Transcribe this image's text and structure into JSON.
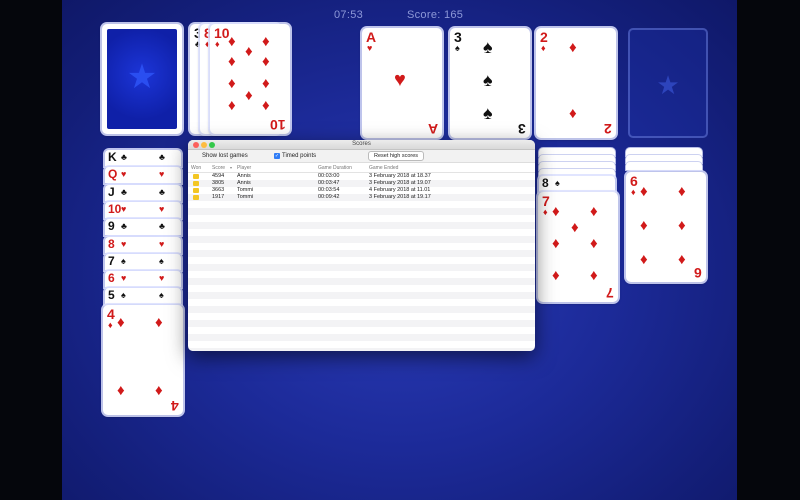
{
  "hud": {
    "time": "07:53",
    "score_label": "Score:",
    "score_value": "165"
  },
  "stock": {
    "state": "face-down",
    "icon": "star-icon"
  },
  "waste": [
    {
      "rank": "3",
      "suit": "♣",
      "color": "black"
    },
    {
      "rank": "8",
      "suit": "♦",
      "color": "red"
    },
    {
      "rank": "10",
      "suit": "♦",
      "color": "red"
    }
  ],
  "foundations": [
    {
      "rank": "A",
      "suit": "♥",
      "color": "red"
    },
    {
      "rank": "3",
      "suit": "♠",
      "color": "black"
    },
    {
      "rank": "2",
      "suit": "♦",
      "color": "red"
    },
    {
      "rank": "",
      "suit": "",
      "color": "",
      "empty": true
    }
  ],
  "tableau_left": {
    "strips": [
      {
        "rank": "K",
        "suit": "♣",
        "color": "black"
      },
      {
        "rank": "Q",
        "suit": "♥",
        "color": "red"
      },
      {
        "rank": "J",
        "suit": "♣",
        "color": "black"
      },
      {
        "rank": "10",
        "suit": "♥",
        "color": "red"
      },
      {
        "rank": "9",
        "suit": "♣",
        "color": "black"
      },
      {
        "rank": "8",
        "suit": "♥",
        "color": "red"
      },
      {
        "rank": "7",
        "suit": "♠",
        "color": "black"
      },
      {
        "rank": "6",
        "suit": "♥",
        "color": "red"
      },
      {
        "rank": "5",
        "suit": "♠",
        "color": "black"
      }
    ],
    "top": {
      "rank": "4",
      "suit": "♦",
      "color": "red"
    }
  },
  "tableau_mid": {
    "strip": {
      "rank": "8",
      "suit": "♠",
      "color": "black"
    },
    "top": {
      "rank": "7",
      "suit": "♦",
      "color": "red"
    }
  },
  "tableau_right": {
    "top": {
      "rank": "6",
      "suit": "♦",
      "color": "red"
    }
  },
  "scores_window": {
    "title": "Scores",
    "show_lost_label": "Show lost games",
    "timed_label": "Timed points",
    "timed_checked": true,
    "reset_label": "Reset high scores",
    "columns": [
      "Won",
      "Score",
      "Player",
      "Game Duration",
      "Game Ended"
    ],
    "rows": [
      {
        "score": "4594",
        "player": "Annis",
        "duration": "00:03:00",
        "ended": "3 February 2018 at 18.37"
      },
      {
        "score": "3805",
        "player": "Annis",
        "duration": "00:03:47",
        "ended": "3 February 2018 at 19.07"
      },
      {
        "score": "3663",
        "player": "Tommi",
        "duration": "00:03:54",
        "ended": "4 February 2018 at 11.01"
      },
      {
        "score": "1917",
        "player": "Tommi",
        "duration": "00:09:42",
        "ended": "3 February 2018 at 19.17"
      }
    ],
    "colors": {
      "traffic_close": "#fc605c",
      "traffic_min": "#fdbc40",
      "traffic_max": "#34c84a",
      "accent": "#2f7cf6"
    }
  }
}
